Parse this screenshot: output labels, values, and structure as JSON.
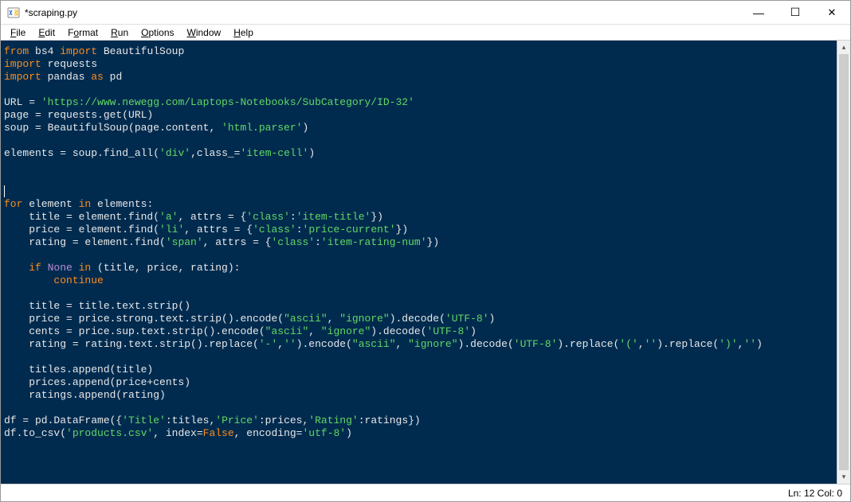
{
  "window": {
    "title": "*scraping.py",
    "minimize": "—",
    "maximize": "☐",
    "close": "✕"
  },
  "menu": {
    "file": "File",
    "edit": "Edit",
    "format": "Format",
    "run": "Run",
    "options": "Options",
    "window": "Window",
    "help": "Help"
  },
  "scrollbar": {
    "up": "▴",
    "down": "▾"
  },
  "statusbar": {
    "position": "Ln: 12  Col: 0"
  },
  "code": {
    "l1_from": "from",
    "l1_bs4": " bs4 ",
    "l1_import": "import",
    "l1_bsoup": " BeautifulSoup",
    "l2_import": "import",
    "l2_req": " requests",
    "l3_import": "import",
    "l3_pandas": " pandas ",
    "l3_as": "as",
    "l3_pd": " pd",
    "l5_a": "URL = ",
    "l5_s": "'https://www.newegg.com/Laptops-Notebooks/SubCategory/ID-32'",
    "l6": "page = requests.get(URL)",
    "l7_a": "soup = BeautifulSoup(page.content, ",
    "l7_s": "'html.parser'",
    "l7_b": ")",
    "l9_a": "elements = soup.find_all(",
    "l9_s1": "'div'",
    "l9_b": ",class_=",
    "l9_s2": "'item-cell'",
    "l9_c": ")",
    "l13_for": "for",
    "l13_a": " element ",
    "l13_in": "in",
    "l13_b": " elements:",
    "l14_a": "    title = element.find(",
    "l14_s1": "'a'",
    "l14_b": ", attrs = {",
    "l14_s2": "'class'",
    "l14_c": ":",
    "l14_s3": "'item-title'",
    "l14_d": "})",
    "l15_a": "    price = element.find(",
    "l15_s1": "'li'",
    "l15_b": ", attrs = {",
    "l15_s2": "'class'",
    "l15_c": ":",
    "l15_s3": "'price-current'",
    "l15_d": "})",
    "l16_a": "    rating = element.find(",
    "l16_s1": "'span'",
    "l16_b": ", attrs = {",
    "l16_s2": "'class'",
    "l16_c": ":",
    "l16_s3": "'item-rating-num'",
    "l16_d": "})",
    "l18_if": "    if",
    "l18_none": " None ",
    "l18_in": "in",
    "l18_a": " (title, price, rating):",
    "l19_cont": "        continue",
    "l21": "    title = title.text.strip()",
    "l22_a": "    price = price.strong.text.strip().encode(",
    "l22_s1": "\"ascii\"",
    "l22_b": ", ",
    "l22_s2": "\"ignore\"",
    "l22_c": ").decode(",
    "l22_s3": "'UTF-8'",
    "l22_d": ")",
    "l23_a": "    cents = price.sup.text.strip().encode(",
    "l23_s1": "\"ascii\"",
    "l23_b": ", ",
    "l23_s2": "\"ignore\"",
    "l23_c": ").decode(",
    "l23_s3": "'UTF-8'",
    "l23_d": ")",
    "l24_a": "    rating = rating.text.strip().replace(",
    "l24_s1": "'-'",
    "l24_b": ",",
    "l24_s2": "''",
    "l24_c": ").encode(",
    "l24_s3": "\"ascii\"",
    "l24_d": ", ",
    "l24_s4": "\"ignore\"",
    "l24_e": ").decode(",
    "l24_s5": "'UTF-8'",
    "l24_f": ").replace(",
    "l24_s6": "'('",
    "l24_g": ",",
    "l24_s7": "''",
    "l24_h": ").replace(",
    "l24_s8": "')'",
    "l24_i": ",",
    "l24_s9": "''",
    "l24_j": ")",
    "l26": "    titles.append(title)",
    "l27": "    prices.append(price+cents)",
    "l28": "    ratings.append(rating)",
    "l30_a": "df = pd.DataFrame({",
    "l30_s1": "'Title'",
    "l30_b": ":titles,",
    "l30_s2": "'Price'",
    "l30_c": ":prices,",
    "l30_s3": "'Rating'",
    "l30_d": ":ratings})",
    "l31_a": "df.to_csv(",
    "l31_s1": "'products.csv'",
    "l31_b": ", index=",
    "l31_false": "False",
    "l31_c": ", encoding=",
    "l31_s2": "'utf-8'",
    "l31_d": ")"
  }
}
